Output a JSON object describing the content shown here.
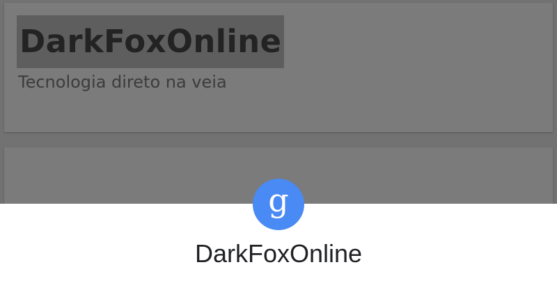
{
  "page": {
    "site_title": "DarkFoxOnline",
    "tagline": "Tecnologia direto na veia"
  },
  "sheet": {
    "icon": "google-g-icon",
    "title": "DarkFoxOnline"
  },
  "colors": {
    "scrim": "#727272",
    "google_blue": "#4a8af4",
    "sheet_background": "#ffffff"
  }
}
